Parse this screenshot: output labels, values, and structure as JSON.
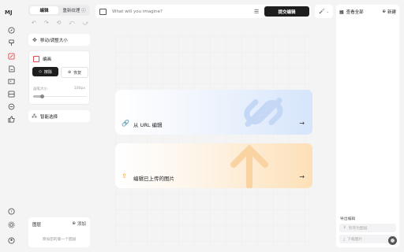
{
  "app": {
    "logo": "MJ"
  },
  "rail": {
    "icons": [
      "compass-icon",
      "brush-icon",
      "edit-icon",
      "note-icon",
      "image-icon",
      "layers-icon",
      "search-chat-icon",
      "thumb-up-icon"
    ],
    "bottom_icons": [
      "help-icon",
      "settings-icon",
      "user-circle-icon"
    ]
  },
  "left_panel": {
    "tabs": [
      {
        "label": "编辑"
      },
      {
        "label": "重新纹理 ⓘ"
      }
    ],
    "move_resize_label": "移动/调整大小",
    "erase_section": {
      "title": "编画",
      "erase_label": "擦除",
      "restore_label": "恢复",
      "brush_size_label": "画笔大小",
      "brush_size_value": "100px"
    },
    "smart_select_label": "智能选择",
    "layers": {
      "title": "图层",
      "add_label": "添加",
      "empty_text": "添加您的第一个图层"
    }
  },
  "top_bar": {
    "prompt_placeholder": "What will you imagine?",
    "submit_label": "提交编辑"
  },
  "main": {
    "url_card_label": "从 URL 编辑",
    "upload_card_label": "编辑已上传的图片"
  },
  "right_panel": {
    "view_all_label": "查看全部",
    "new_label": "新建",
    "export_title": "导出编辑",
    "export_btn1": "另存为图层",
    "export_btn2": "下载图片"
  },
  "colors": {
    "accent_dark": "#1e1e1e",
    "blue_card": "#dce9fb",
    "orange_card": "#fde5c4",
    "red_icon": "#e5484d"
  }
}
